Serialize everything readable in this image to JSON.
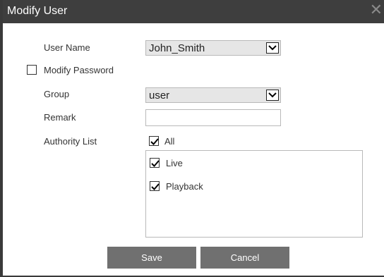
{
  "dialog": {
    "title": "Modify User",
    "close_symbol": "✕"
  },
  "form": {
    "user_name_label": "User Name",
    "user_name_value": "John_Smith",
    "modify_password_label": "Modify Password",
    "modify_password_checked": false,
    "group_label": "Group",
    "group_value": "user",
    "remark_label": "Remark",
    "remark_value": "",
    "authority_label": "Authority List",
    "all_label": "All",
    "all_checked": true,
    "authorities": [
      {
        "label": "Live",
        "checked": true
      },
      {
        "label": "Playback",
        "checked": true
      }
    ]
  },
  "buttons": {
    "save_label": "Save",
    "cancel_label": "Cancel"
  },
  "colors": {
    "titlebar": "#3e3e3e",
    "button": "#707070"
  }
}
